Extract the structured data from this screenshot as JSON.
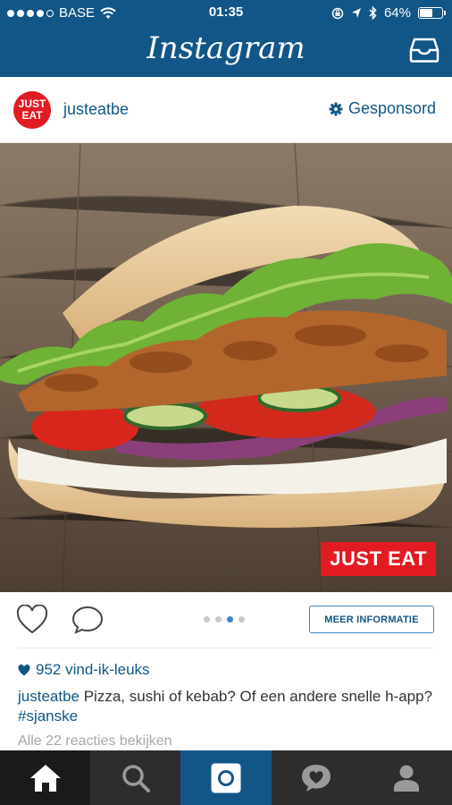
{
  "status_bar": {
    "carrier": "BASE",
    "time": "01:35",
    "battery": "64%",
    "battery_level": 0.64,
    "signal_bars_filled": 4,
    "signal_bars_total": 5
  },
  "nav": {
    "title": "Instagram"
  },
  "post": {
    "avatar_text": "JUST EAT",
    "username": "justeatbe",
    "sponsored_label": "Gesponsord",
    "brand_badge": "JUST EAT",
    "carousel_total": 4,
    "carousel_active": 3,
    "more_info_label": "MEER INFORMATIE",
    "likes": "952 vind-ik-leuks",
    "caption_user": "justeatbe",
    "caption_text": " Pizza, sushi of kebab? Of een andere snelle h-app? ",
    "caption_hashtag": "#sjanske",
    "view_comments": "Alle 22 reacties bekijken"
  },
  "colors": {
    "brand_blue": "#125688",
    "accent_blue": "#3d83c5",
    "justeat_red": "#e21b23",
    "tabbar_bg": "#2d2d2d"
  },
  "icons": [
    "wifi-icon",
    "lock-rotation-icon",
    "location-icon",
    "bluetooth-icon",
    "inbox-icon",
    "sponsored-gear-icon",
    "heart-icon",
    "comment-icon",
    "home-icon",
    "search-icon",
    "camera-icon",
    "activity-heart-icon",
    "profile-icon"
  ]
}
